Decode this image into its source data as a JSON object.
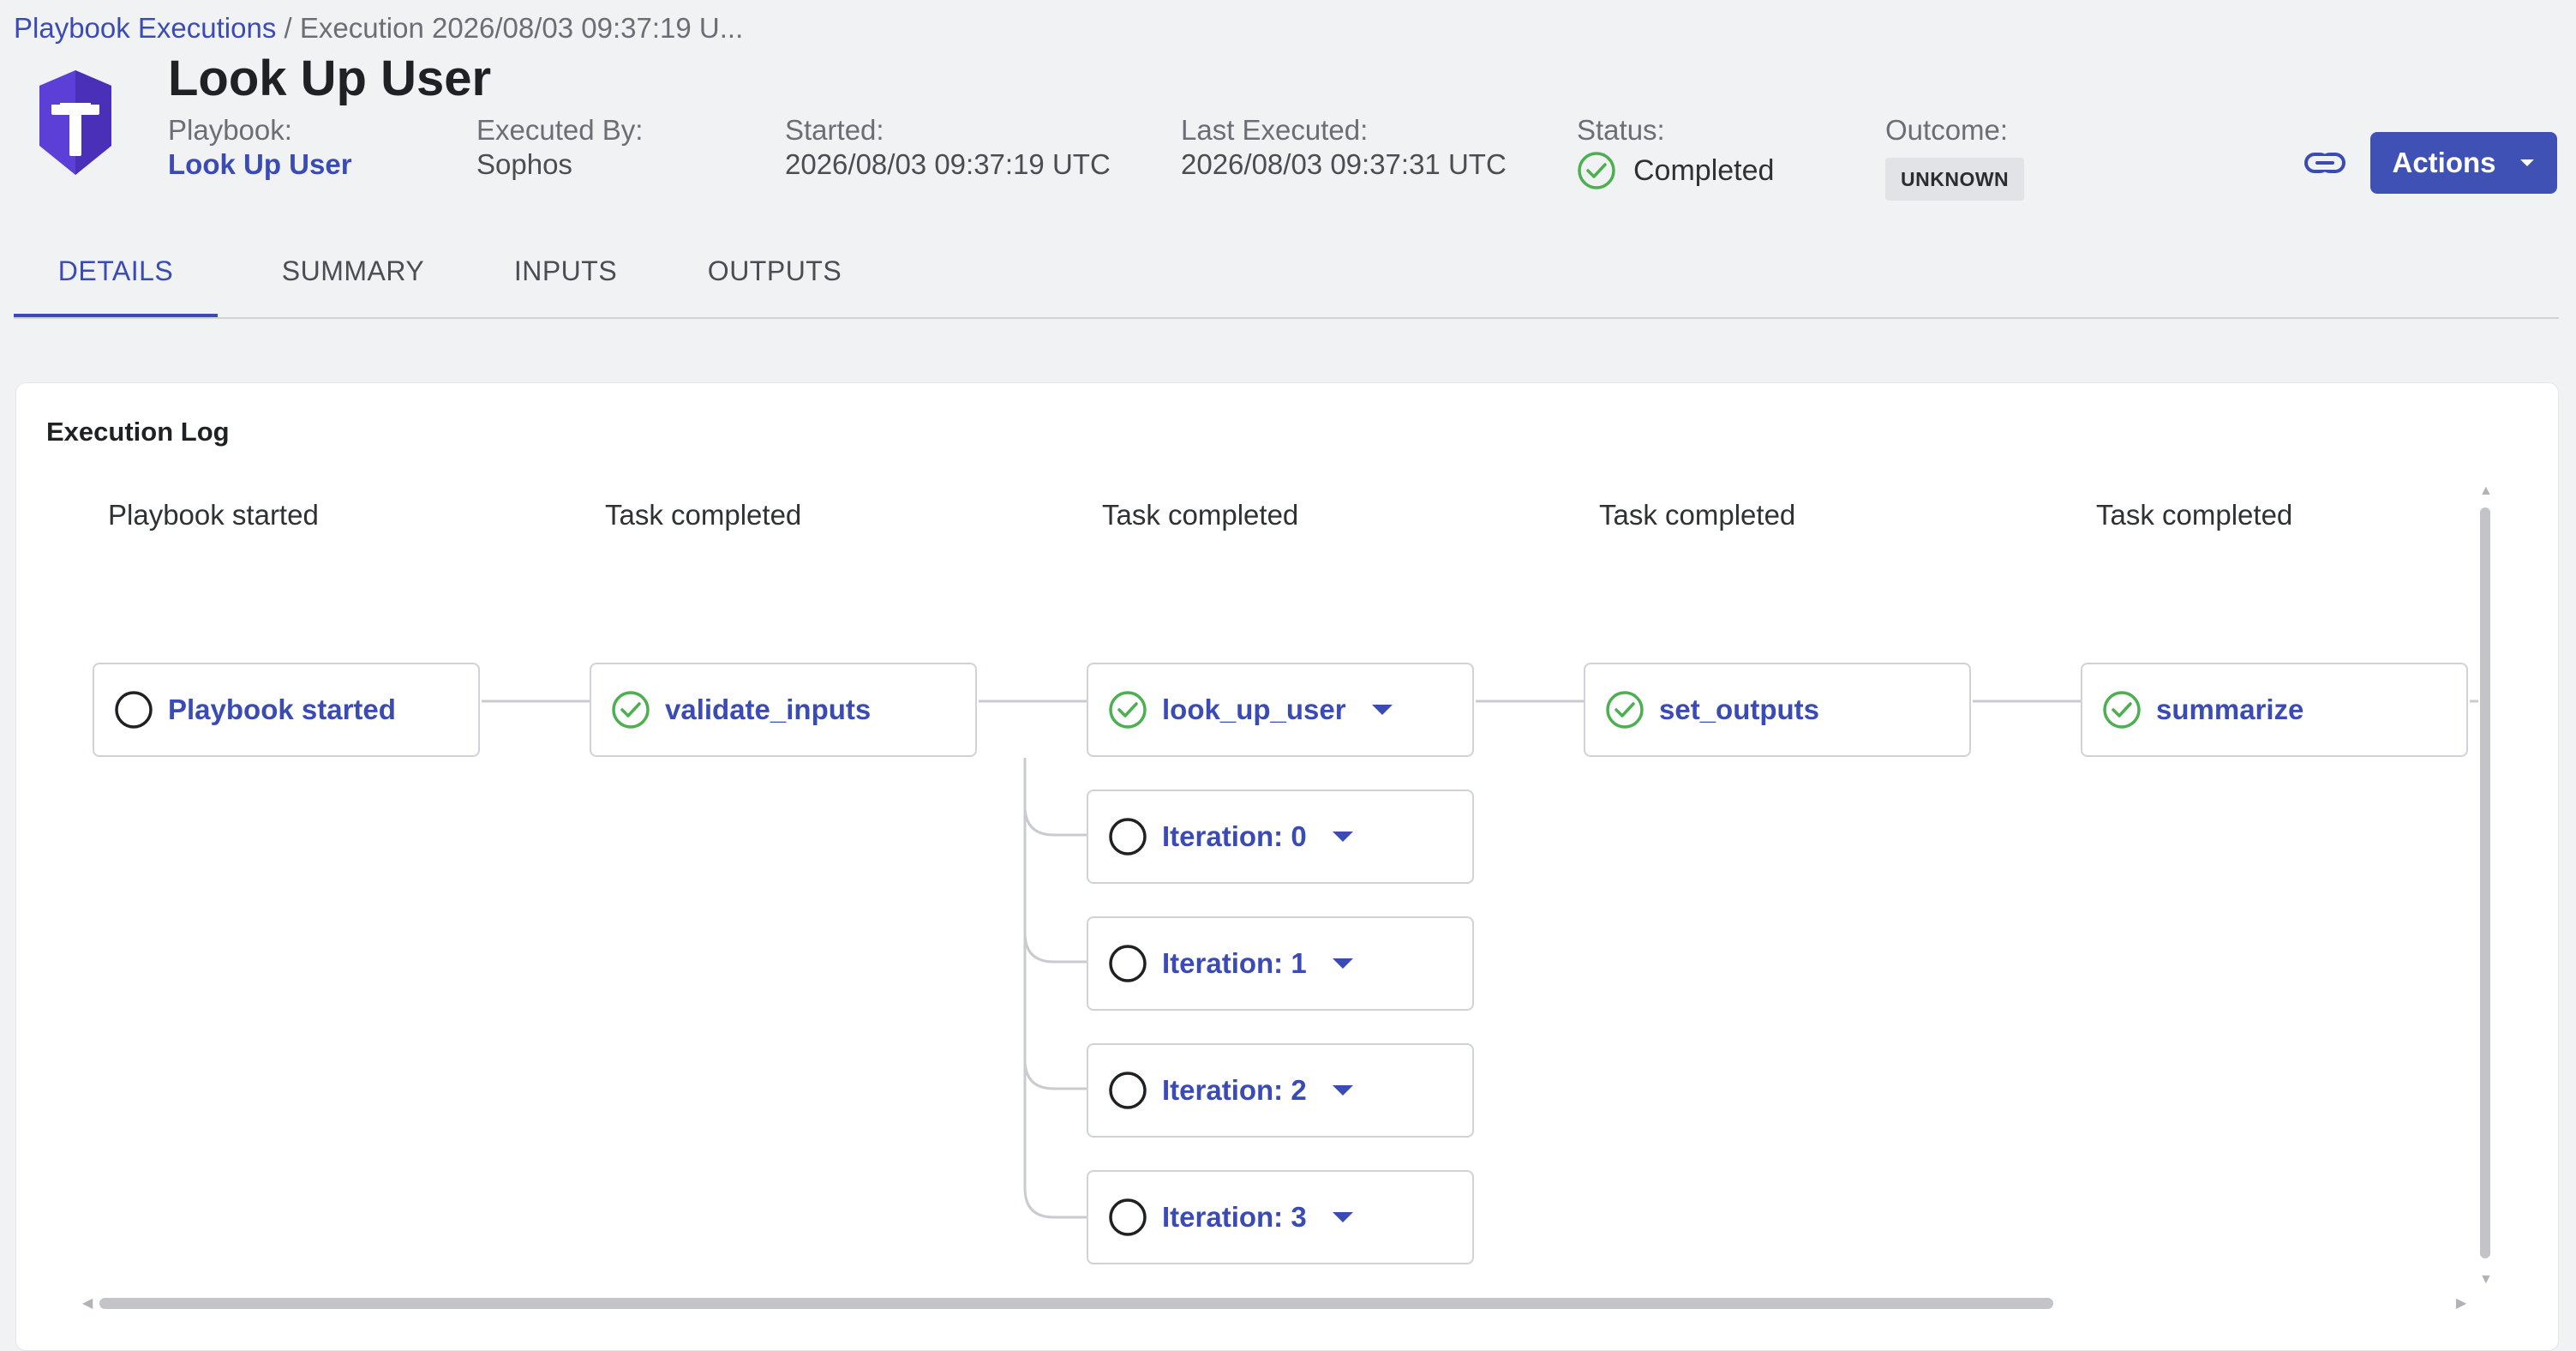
{
  "breadcrumb": {
    "parent": "Playbook Executions",
    "separator": "/",
    "current": "Execution 2026/08/03 09:37:19 U..."
  },
  "header": {
    "title": "Look Up User",
    "playbook_label": "Playbook:",
    "playbook_value": "Look Up User",
    "executed_by_label": "Executed By:",
    "executed_by_value": "Sophos",
    "started_label": "Started:",
    "started_value": "2026/08/03 09:37:19 UTC",
    "last_executed_label": "Last Executed:",
    "last_executed_value": "2026/08/03 09:37:31 UTC",
    "status_label": "Status:",
    "status_value": "Completed",
    "outcome_label": "Outcome:",
    "outcome_value": "UNKNOWN",
    "actions_label": "Actions"
  },
  "tabs": [
    {
      "label": "DETAILS",
      "active": true
    },
    {
      "label": "SUMMARY",
      "active": false
    },
    {
      "label": "INPUTS",
      "active": false
    },
    {
      "label": "OUTPUTS",
      "active": false
    }
  ],
  "execution_log": {
    "title": "Execution Log",
    "columns": [
      {
        "heading": "Playbook started",
        "node": {
          "label": "Playbook started",
          "state": "pending",
          "expandable": false
        }
      },
      {
        "heading": "Task completed",
        "node": {
          "label": "validate_inputs",
          "state": "success",
          "expandable": false
        }
      },
      {
        "heading": "Task completed",
        "node": {
          "label": "look_up_user",
          "state": "success",
          "expandable": true
        }
      },
      {
        "heading": "Task completed",
        "node": {
          "label": "set_outputs",
          "state": "success",
          "expandable": false
        }
      },
      {
        "heading": "Task completed",
        "node": {
          "label": "summarize",
          "state": "success",
          "expandable": false
        }
      }
    ],
    "iterations": [
      {
        "label": "Iteration: 0",
        "state": "pending"
      },
      {
        "label": "Iteration: 1",
        "state": "pending"
      },
      {
        "label": "Iteration: 2",
        "state": "pending"
      },
      {
        "label": "Iteration: 3",
        "state": "pending"
      }
    ]
  },
  "icons": {
    "logo": "shield-logo-icon",
    "link": "link-icon",
    "success": "check-circle-icon",
    "pending": "empty-circle-icon",
    "caret": "caret-down-icon"
  },
  "colors": {
    "accent": "#3f51b5",
    "link_text": "#3a4bb5",
    "success": "#4caf50",
    "logo": "#5b3fd6"
  }
}
